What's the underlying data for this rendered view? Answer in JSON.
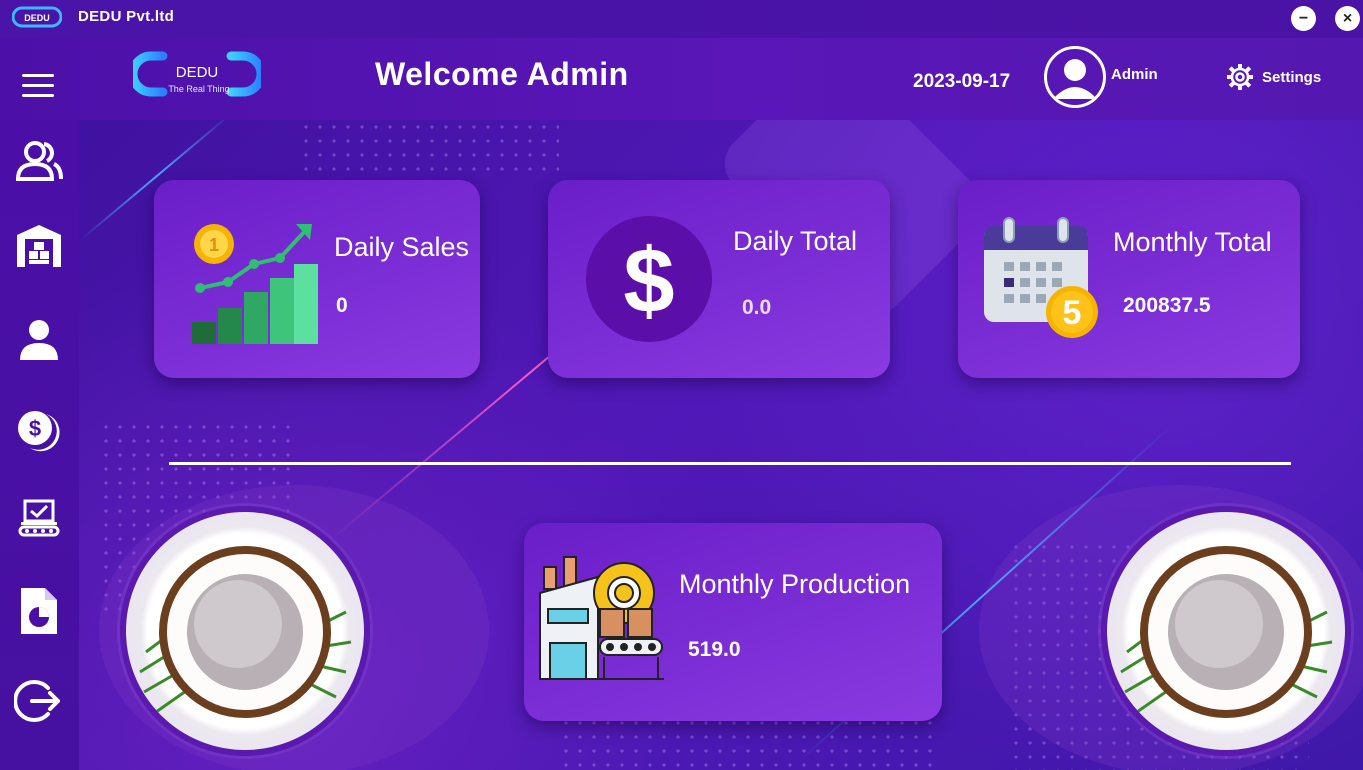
{
  "window": {
    "title": "DEDU Pvt.ltd",
    "minimize": "−",
    "close": "×"
  },
  "header": {
    "welcome": "Welcome Admin",
    "date": "2023-09-17",
    "user": "Admin",
    "settings": "Settings",
    "logo_text": "DEDU",
    "logo_tagline": "The Real Thing"
  },
  "sidebar": {
    "items": [
      {
        "icon": "users-icon"
      },
      {
        "icon": "warehouse-icon"
      },
      {
        "icon": "user-icon"
      },
      {
        "icon": "dollar-coin-icon"
      },
      {
        "icon": "production-line-icon"
      },
      {
        "icon": "report-icon"
      },
      {
        "icon": "logout-icon"
      }
    ]
  },
  "cards": {
    "daily_sales": {
      "title": "Daily Sales",
      "value": "0"
    },
    "daily_total": {
      "title": "Daily Total",
      "value": "0.0"
    },
    "monthly_total": {
      "title": "Monthly Total",
      "value": "200837.5",
      "calendar_badge": "5"
    },
    "monthly_production": {
      "title": "Monthly Production",
      "value": "519.0"
    }
  },
  "colors": {
    "accent": "#5a16b8",
    "card": "#7a2ed8",
    "dollar_circle": "#5b0ea8"
  }
}
